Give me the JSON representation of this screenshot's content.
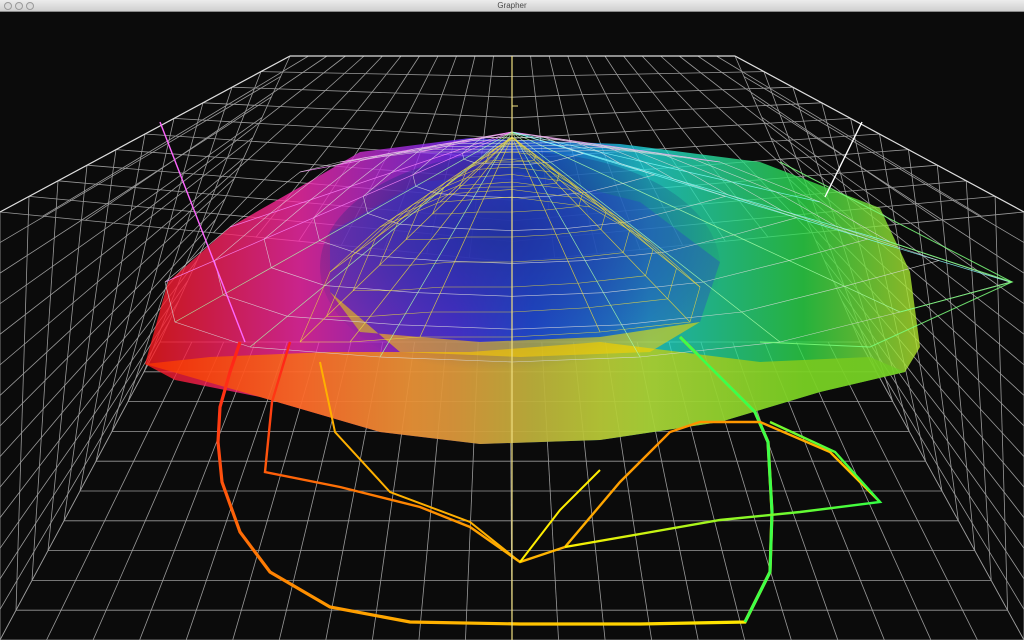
{
  "window": {
    "title": "Grapher"
  },
  "axes": {
    "axis_colors": {
      "vertical": "#f0e080",
      "left": "#ff66ff",
      "right": "#ffffff"
    }
  },
  "surfaces": [
    {
      "name": "gamut-volume-outer",
      "style": "solid-translucent"
    },
    {
      "name": "gamut-wireframe-white",
      "style": "wireframe",
      "color": "#ffffff"
    },
    {
      "name": "gamut-wireframe-yellow",
      "style": "wireframe",
      "color": "#e0d040"
    }
  ],
  "curves": [
    {
      "name": "locus-outer",
      "colors": [
        "#ff2020",
        "#ff9900",
        "#ffff00",
        "#40ff40"
      ]
    },
    {
      "name": "locus-inner",
      "colors": [
        "#ff2020",
        "#ffcc00",
        "#ffff40",
        "#40ff60"
      ]
    }
  ],
  "icons": {
    "close": "circle-icon",
    "minimize": "circle-icon",
    "zoom": "circle-icon"
  }
}
